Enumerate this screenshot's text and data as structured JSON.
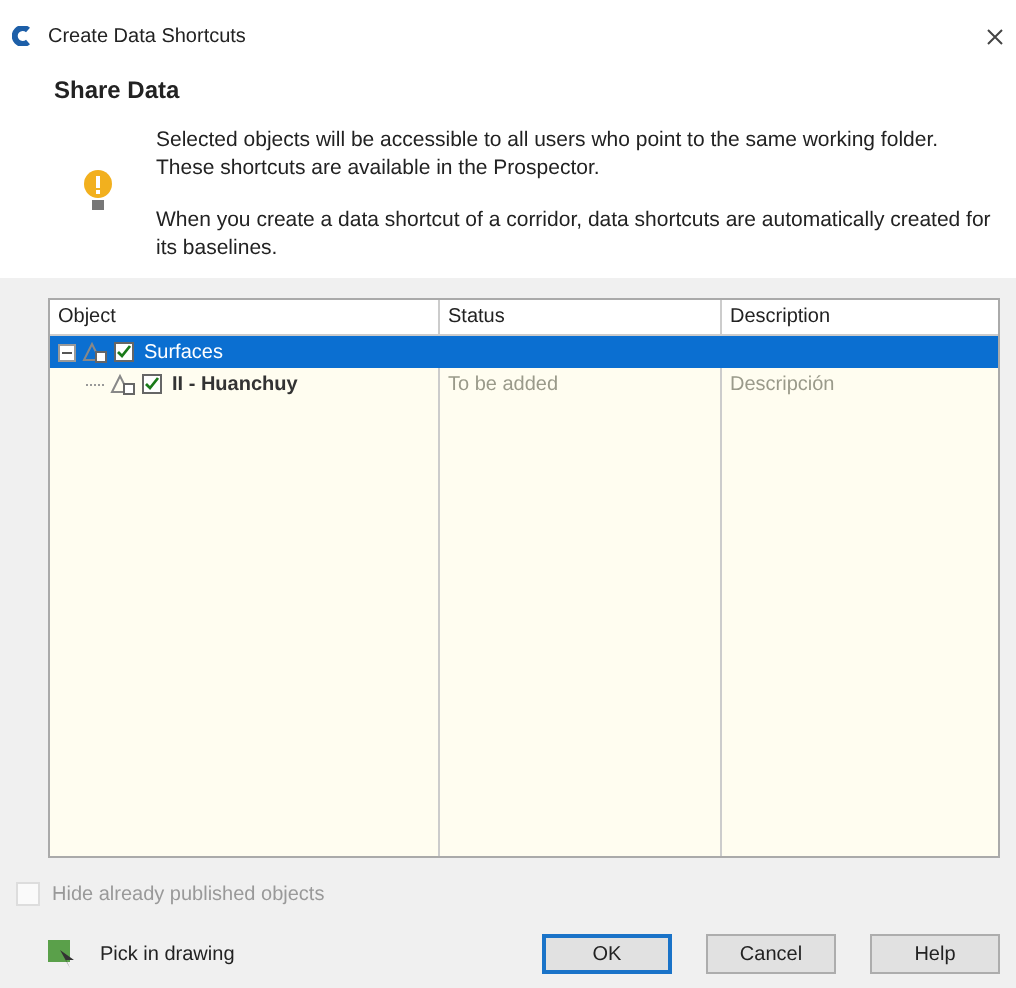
{
  "window": {
    "title": "Create Data Shortcuts"
  },
  "header": {
    "title": "Share Data",
    "paragraphs": [
      "Selected objects will be accessible to all users who point to the same working folder. These shortcuts are available in the Prospector.",
      "When you create a data shortcut of a corridor, data shortcuts are automatically created for its baselines."
    ]
  },
  "table": {
    "columns": [
      "Object",
      "Status",
      "Description"
    ],
    "rows": [
      {
        "name": "Surfaces",
        "status": "",
        "description": "",
        "checked": true,
        "selected": true,
        "expanded": true,
        "children": [
          {
            "name": "II - Huanchuy",
            "status": "To be added",
            "description": "Descripción",
            "checked": true,
            "selected": false
          }
        ]
      }
    ]
  },
  "hide_published": {
    "label": "Hide already published objects",
    "checked": false,
    "disabled": true
  },
  "pick_button": {
    "label": "Pick in drawing"
  },
  "buttons": [
    {
      "label": "OK",
      "kind": "default"
    },
    {
      "label": "Cancel",
      "kind": "normal"
    },
    {
      "label": "Help",
      "kind": "normal"
    }
  ]
}
